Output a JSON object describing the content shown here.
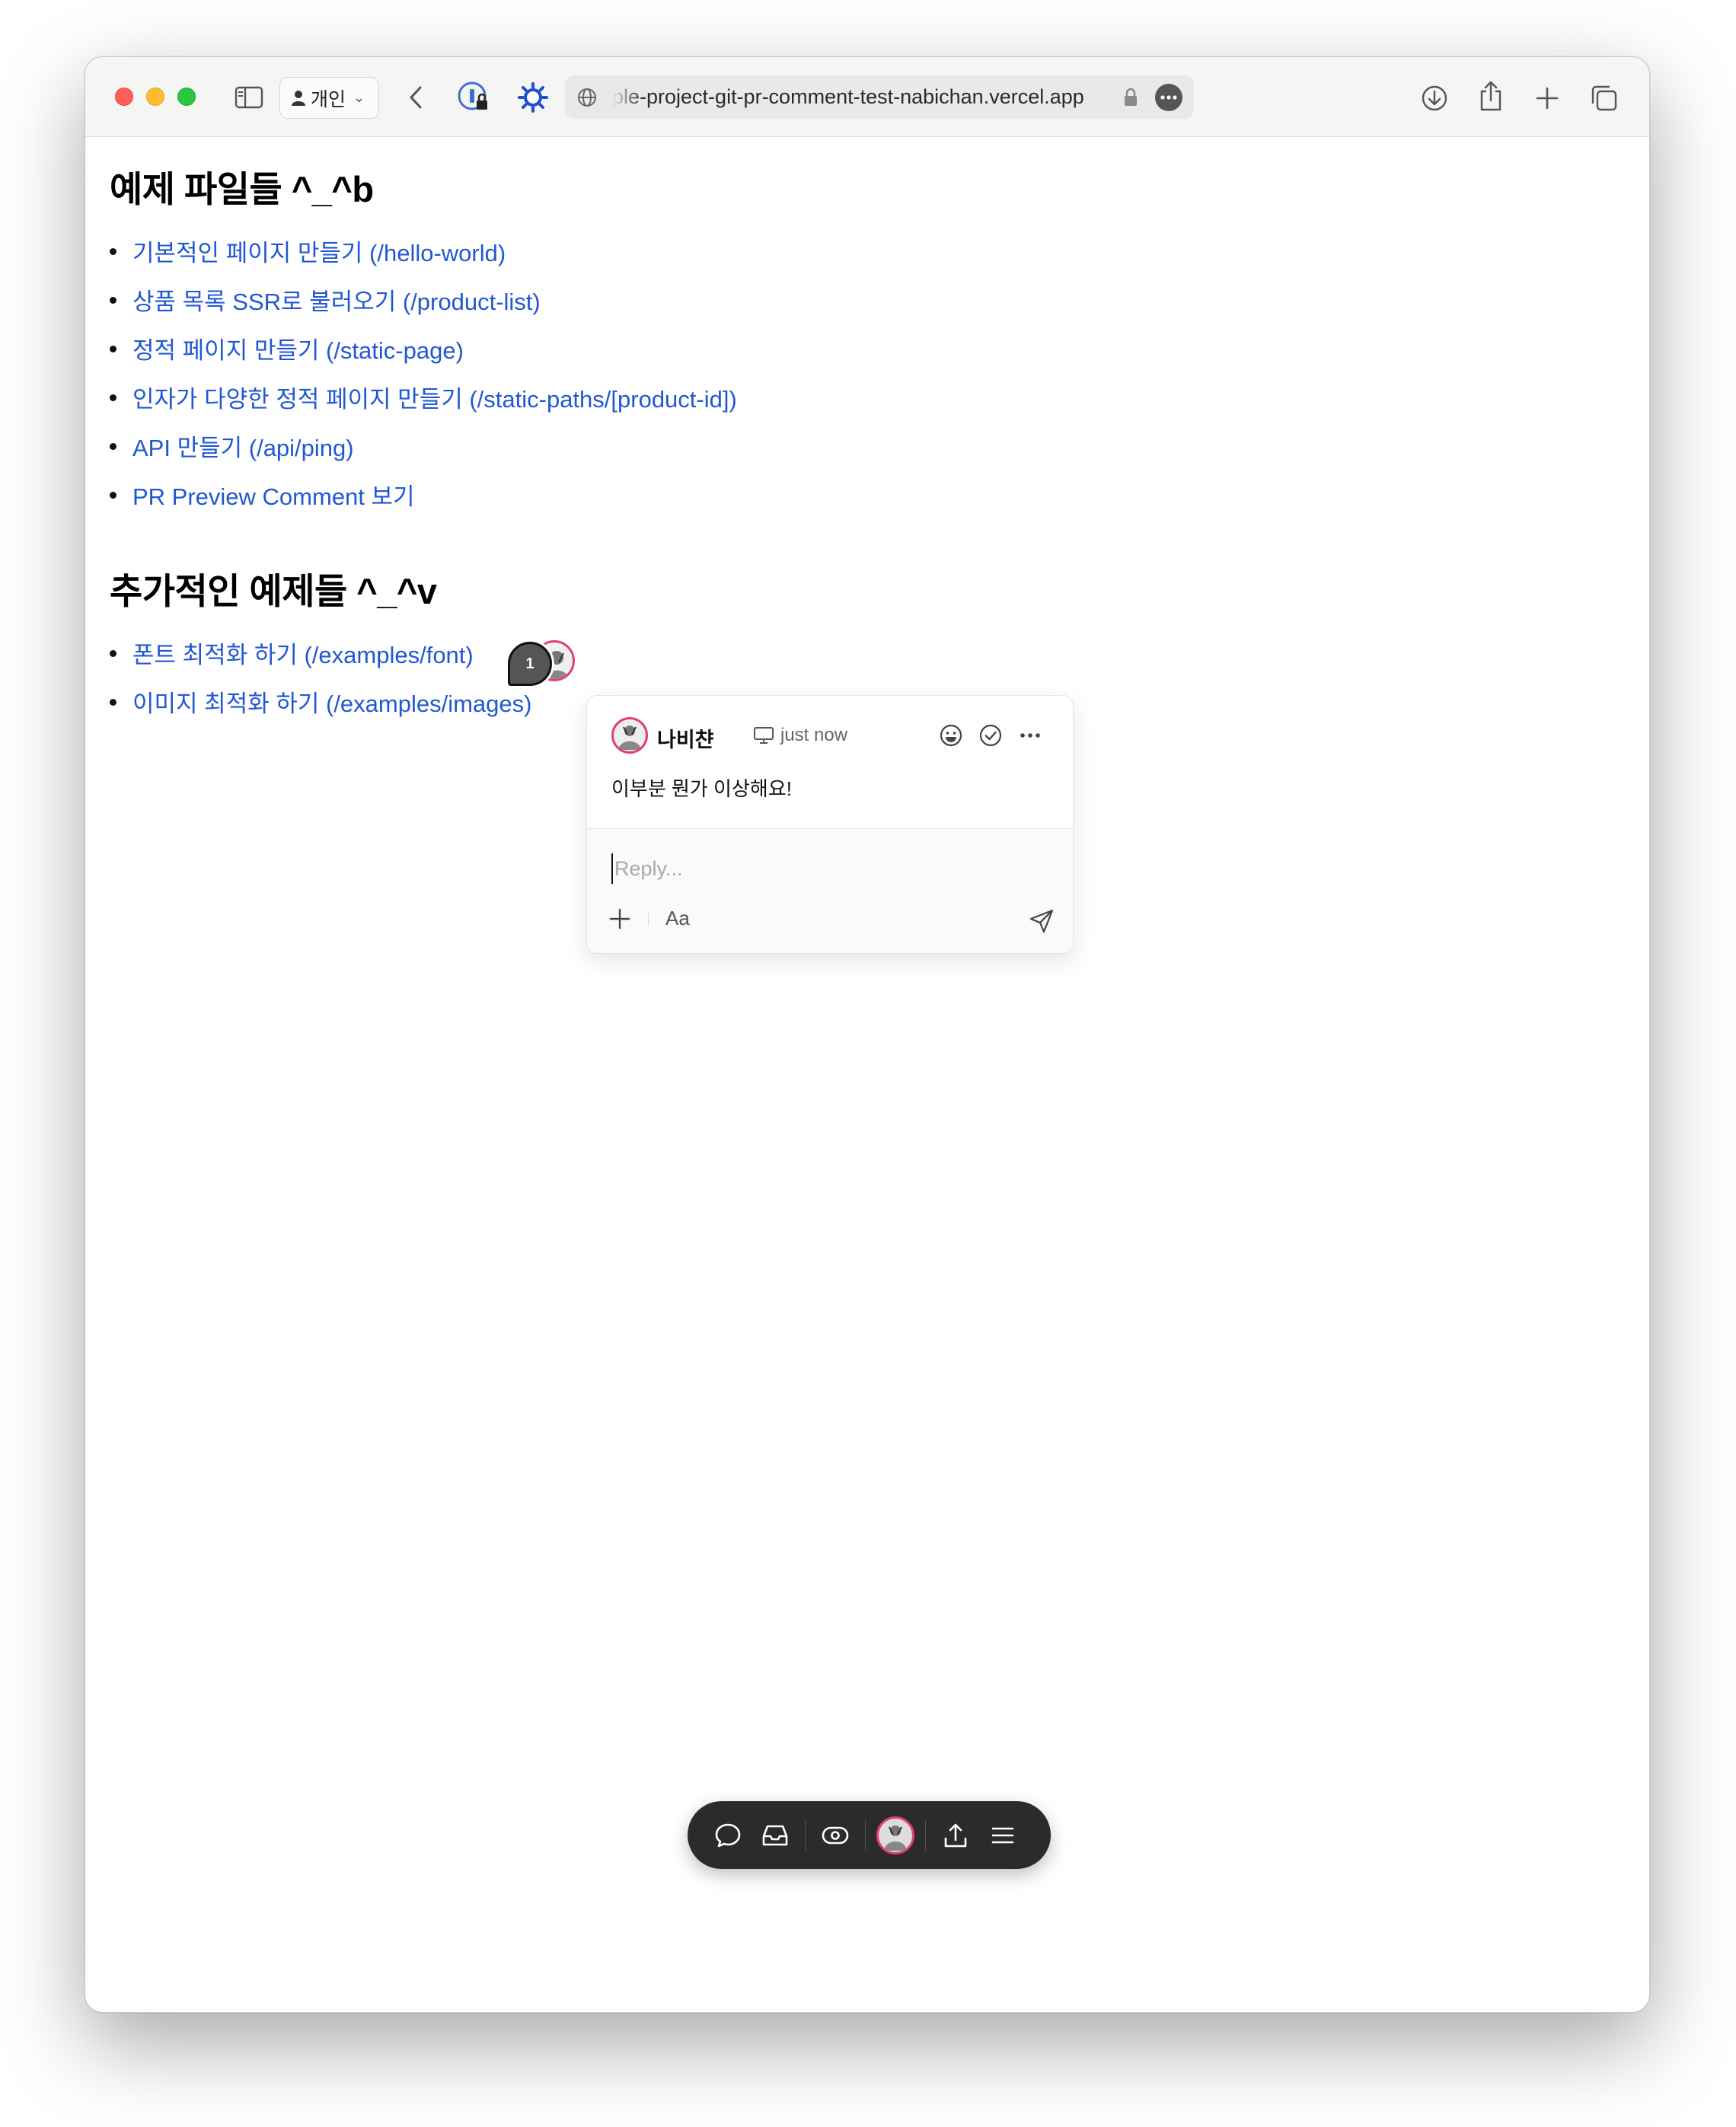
{
  "browser": {
    "profile_label": "개인",
    "url": "ple-project-git-pr-comment-test-nabichan.vercel.app"
  },
  "page": {
    "section1": {
      "heading": "예제 파일들 ^_^b",
      "links": [
        "기본적인 페이지 만들기 (/hello-world)",
        "상품 목록 SSR로 불러오기 (/product-list)",
        "정적 페이지 만들기 (/static-page)",
        "인자가 다양한 정적 페이지 만들기 (/static-paths/[product-id])",
        "API 만들기 (/api/ping)",
        "PR Preview Comment 보기"
      ]
    },
    "section2": {
      "heading": "추가적인 예제들 ^_^v",
      "links": [
        "폰트 최적화 하기 (/examples/font)",
        "이미지 최적화 하기 (/examples/images)"
      ]
    }
  },
  "comment": {
    "pin_number": "1",
    "author": "나비챤",
    "time": "just now",
    "body": "이부분 뭔가 이상해요!",
    "reply_placeholder": "Reply...",
    "format_label": "Aa"
  },
  "colors": {
    "link": "#2157d6",
    "avatar_ring": "#e23d7a",
    "toolbar_bg": "#2b2b2b"
  }
}
